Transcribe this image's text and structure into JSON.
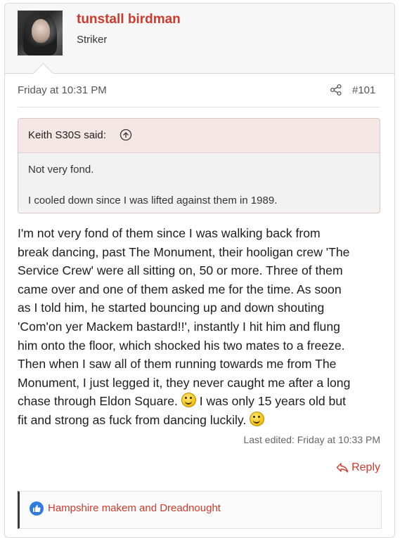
{
  "post": {
    "username": "tunstall birdman",
    "user_title": "Striker",
    "date": "Friday at 10:31 PM",
    "number": "#101",
    "quote": {
      "author": "Keith S30S said:",
      "lines": [
        "Not very fond.",
        "I cooled down since I was lifted against them in 1989."
      ]
    },
    "body_lines": [
      "I'm not very fond of them since I was walking back from",
      "break dancing, past The Monument, their hooligan crew 'The",
      "Service Crew' were all sitting on, 50 or more. Three of them",
      "came over and one of them asked me for the time. As soon",
      "as I told him, he started bouncing up and down shouting",
      "'Com'on yer Mackem bastard!!', instantly I hit him and flung",
      "him onto the floor, which shocked his two mates to a freeze.",
      "Then when I saw all of them running towards me from The",
      "Monument, I just legged it, they never caught me after a long"
    ],
    "body_line10a": "chase through Eldon Square.",
    "body_line10b": "I was only 15 years old but",
    "body_line11": "fit and strong as fuck from dancing luckily.",
    "last_edited": "Last edited: Friday at 10:33 PM",
    "reply_label": "Reply",
    "reactions": "Hampshire makem and Dreadnought"
  },
  "icons": {
    "share": "share-icon",
    "quote_jump": "arrow-up-circle-icon",
    "emoji": "grin-emoji-icon",
    "reply": "reply-arrow-icon",
    "like": "thumbs-up-icon"
  },
  "colors": {
    "accent": "#d03a2a",
    "like": "#2f7be0",
    "quote_header": "#f5e6e6"
  }
}
